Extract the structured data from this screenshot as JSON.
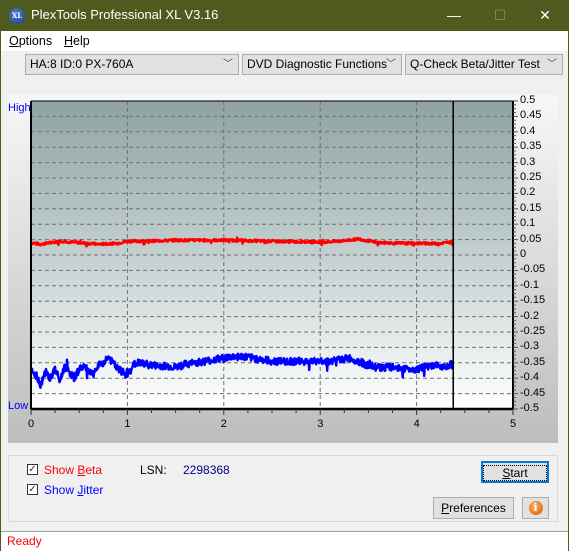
{
  "window": {
    "title": "PlexTools Professional XL V3.16",
    "icon_label": "XL",
    "minimize": "—",
    "maximize": "☐",
    "close": "✕"
  },
  "menu": {
    "items": [
      {
        "label": "Options",
        "accel": "O"
      },
      {
        "label": "Help",
        "accel": "H"
      }
    ]
  },
  "toolbar": {
    "drive_select": "HA:8 ID:0  PX-760A",
    "function_select": "DVD Diagnostic Functions",
    "test_select": "Q-Check Beta/Jitter Test",
    "dropdown_glyph": "﹀"
  },
  "chart_data": {
    "type": "line",
    "title": "",
    "left_labels": {
      "top": "High",
      "bottom": "Low"
    },
    "xlabel": "",
    "ylabel": "",
    "xlim": [
      0,
      5
    ],
    "ylim": [
      -0.5,
      0.5
    ],
    "x_ticks": [
      "0",
      "1",
      "2",
      "3",
      "4",
      "5"
    ],
    "y_ticks": [
      "0.5",
      "0.45",
      "0.4",
      "0.35",
      "0.3",
      "0.25",
      "0.2",
      "0.15",
      "0.1",
      "0.05",
      "0",
      "-0.05",
      "-0.1",
      "-0.15",
      "-0.2",
      "-0.25",
      "-0.3",
      "-0.35",
      "-0.4",
      "-0.45",
      "-0.5"
    ],
    "grid": true,
    "end_marker_x": 4.38,
    "series": [
      {
        "name": "Beta",
        "color": "#ff0000",
        "x": [
          0,
          0.1,
          0.2,
          0.3,
          0.5,
          0.7,
          0.9,
          1.0,
          1.2,
          1.5,
          1.8,
          2.0,
          2.3,
          2.6,
          3.0,
          3.2,
          3.4,
          3.6,
          3.8,
          4.0,
          4.2,
          4.38
        ],
        "values": [
          0.04,
          0.035,
          0.04,
          0.045,
          0.04,
          0.035,
          0.038,
          0.045,
          0.045,
          0.048,
          0.048,
          0.048,
          0.046,
          0.044,
          0.042,
          0.045,
          0.052,
          0.04,
          0.038,
          0.038,
          0.037,
          0.042
        ]
      },
      {
        "name": "Jitter",
        "color": "#0000ff",
        "x": [
          0,
          0.05,
          0.1,
          0.15,
          0.2,
          0.25,
          0.3,
          0.35,
          0.4,
          0.45,
          0.5,
          0.55,
          0.6,
          0.65,
          0.7,
          0.75,
          0.8,
          0.85,
          0.9,
          0.95,
          1.0,
          1.05,
          1.1,
          1.2,
          1.3,
          1.4,
          1.5,
          1.6,
          1.7,
          1.8,
          1.9,
          2.0,
          2.1,
          2.2,
          2.3,
          2.4,
          2.5,
          2.6,
          2.7,
          2.8,
          2.9,
          3.0,
          3.1,
          3.2,
          3.3,
          3.4,
          3.5,
          3.6,
          3.7,
          3.8,
          3.9,
          4.0,
          4.1,
          4.2,
          4.3,
          4.38
        ],
        "values": [
          -0.37,
          -0.39,
          -0.42,
          -0.38,
          -0.4,
          -0.37,
          -0.41,
          -0.36,
          -0.38,
          -0.4,
          -0.37,
          -0.36,
          -0.38,
          -0.39,
          -0.36,
          -0.35,
          -0.33,
          -0.35,
          -0.37,
          -0.38,
          -0.39,
          -0.36,
          -0.35,
          -0.355,
          -0.36,
          -0.36,
          -0.365,
          -0.355,
          -0.35,
          -0.345,
          -0.34,
          -0.335,
          -0.33,
          -0.33,
          -0.335,
          -0.34,
          -0.345,
          -0.345,
          -0.345,
          -0.345,
          -0.345,
          -0.345,
          -0.345,
          -0.34,
          -0.335,
          -0.345,
          -0.36,
          -0.365,
          -0.365,
          -0.365,
          -0.37,
          -0.37,
          -0.365,
          -0.36,
          -0.36,
          -0.355
        ]
      }
    ]
  },
  "controls": {
    "show_beta": {
      "label_pre": "Show ",
      "accel": "B",
      "label_post": "eta",
      "checked": true,
      "check_glyph": "✓"
    },
    "show_jitter": {
      "label_pre": "Show ",
      "accel": "J",
      "label_post": "itter",
      "checked": true,
      "check_glyph": "✓"
    },
    "lsn_label": "LSN:",
    "lsn_value": "2298368",
    "start_button": {
      "accel": "S",
      "rest": "tart"
    },
    "preferences_button": {
      "accel": "P",
      "rest": "references"
    },
    "info_button_glyph": "i"
  },
  "status": {
    "text": "Ready"
  },
  "colors": {
    "titlebar": "#4f5a1f",
    "beta": "#ff0000",
    "jitter": "#0000ff",
    "lsn_value": "#000080",
    "status": "#ff0000"
  }
}
